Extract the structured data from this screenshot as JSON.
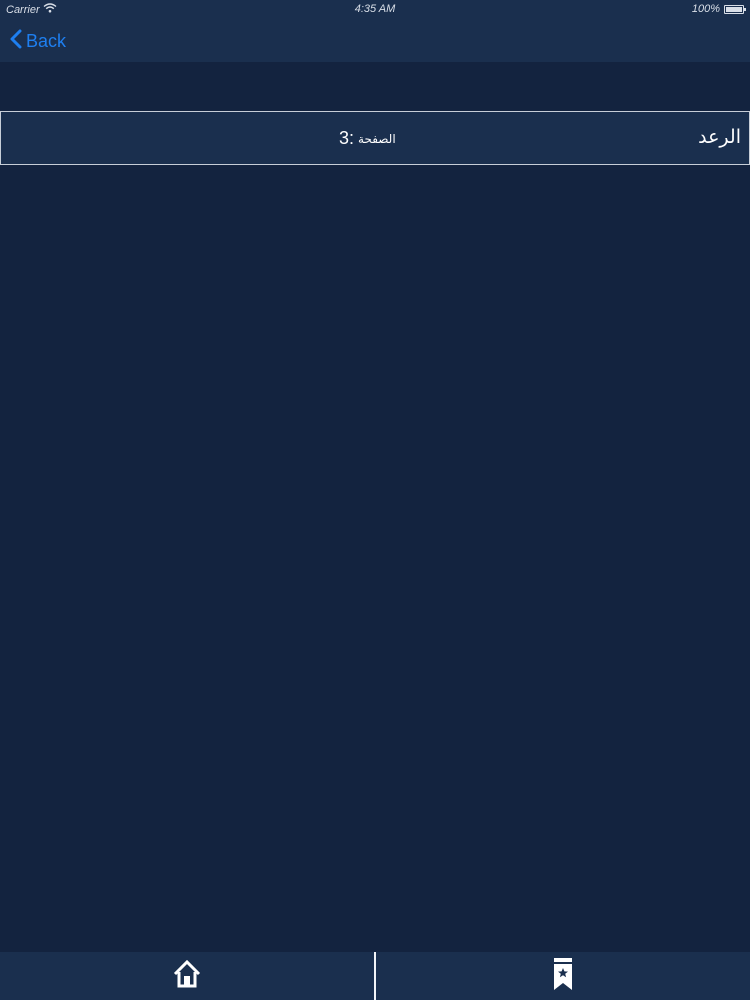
{
  "status_bar": {
    "carrier": "Carrier",
    "time": "4:35 AM",
    "battery": "100%"
  },
  "nav": {
    "back_label": "Back"
  },
  "list": {
    "items": [
      {
        "title": "الرعد",
        "page_label": "الصفحة",
        "page_number": "3:"
      }
    ]
  },
  "tab_bar": {
    "items": [
      {
        "icon": "home-icon"
      },
      {
        "icon": "bookmark-icon"
      }
    ]
  },
  "colors": {
    "background": "#13233f",
    "bars": "#1a2f4e",
    "accent": "#1e7ff0",
    "text": "#ffffff"
  }
}
